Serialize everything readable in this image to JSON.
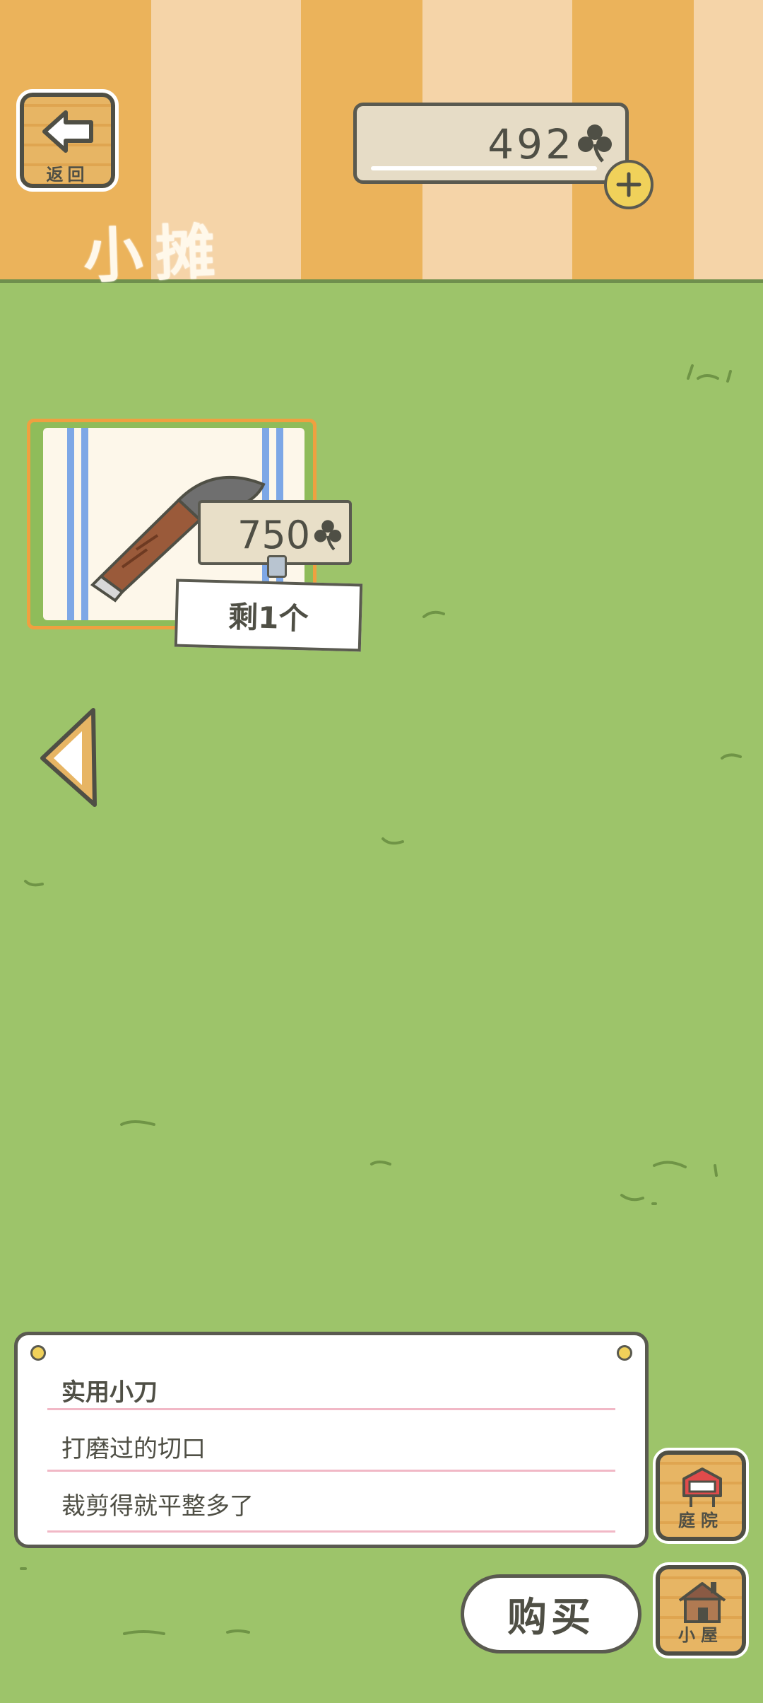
{
  "header": {
    "title": "小摊",
    "back_label": "返回",
    "coins": "492",
    "icons": {
      "back": "arrow-left-icon",
      "currency": "clover-icon",
      "add": "plus-icon"
    }
  },
  "item": {
    "price": "750",
    "stock": "剩1个",
    "icon": "knife-icon"
  },
  "navigation": {
    "prev_icon": "triangle-left-arrow-icon"
  },
  "description": {
    "name": "实用小刀",
    "line1": "打磨过的切口",
    "line2": "裁剪得就平整多了"
  },
  "side_buttons": {
    "yard": "庭院",
    "house": "小屋"
  },
  "buy_label": "购买",
  "colors": {
    "grass": "#9dc46a",
    "stripe_light": "#f5d4a8",
    "stripe_dark": "#ebb35b",
    "ink": "#4f4f45"
  }
}
